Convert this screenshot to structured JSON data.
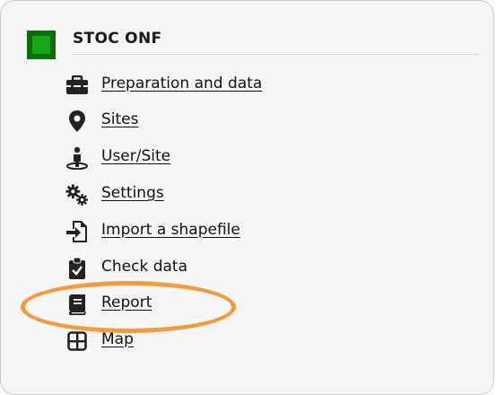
{
  "header": {
    "title": "STOC ONF",
    "accent_color": "#14a814"
  },
  "menu": [
    {
      "label": "Preparation and data",
      "icon": "toolbox-icon",
      "linked": true
    },
    {
      "label": "Sites",
      "icon": "map-pin-icon",
      "linked": true
    },
    {
      "label": "User/Site",
      "icon": "user-location-icon",
      "linked": true
    },
    {
      "label": "Settings",
      "icon": "gears-icon",
      "linked": true
    },
    {
      "label": "Import a shapefile",
      "icon": "file-import-icon",
      "linked": true
    },
    {
      "label": "Check data",
      "icon": "clipboard-check-icon",
      "linked": false
    },
    {
      "label": "Report",
      "icon": "book-icon",
      "linked": true
    },
    {
      "label": "Map",
      "icon": "grid-map-icon",
      "linked": true
    }
  ],
  "highlight": {
    "target": "Report",
    "color": "#f28b1e"
  }
}
